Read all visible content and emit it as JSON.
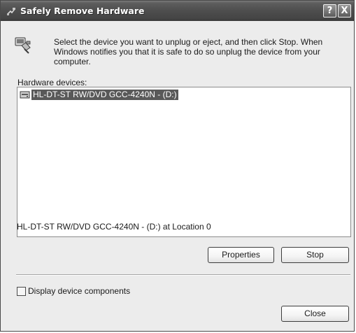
{
  "window": {
    "title": "Safely Remove Hardware",
    "help_glyph": "?",
    "close_glyph": "X"
  },
  "instructions": "Select the device you want to unplug or eject, and then click Stop. When Windows notifies you that it is safe to do so unplug the device from your computer.",
  "hardware": {
    "label": "Hardware devices:",
    "devices": [
      {
        "label": "HL-DT-ST RW/DVD GCC-4240N - (D:)",
        "icon": "optical-drive-icon",
        "selected": true
      }
    ],
    "location_text": "HL-DT-ST RW/DVD GCC-4240N - (D:) at Location 0"
  },
  "buttons": {
    "properties": "Properties",
    "stop": "Stop",
    "close": "Close"
  },
  "options": {
    "display_components_label": "Display device components",
    "display_components_checked": false
  },
  "icons": {
    "title": "safely-remove-icon",
    "header": "usb-device-icon"
  },
  "colors": {
    "titlebar": "#4e4e4e",
    "selection": "#595959",
    "dialog_bg": "#ececec"
  }
}
